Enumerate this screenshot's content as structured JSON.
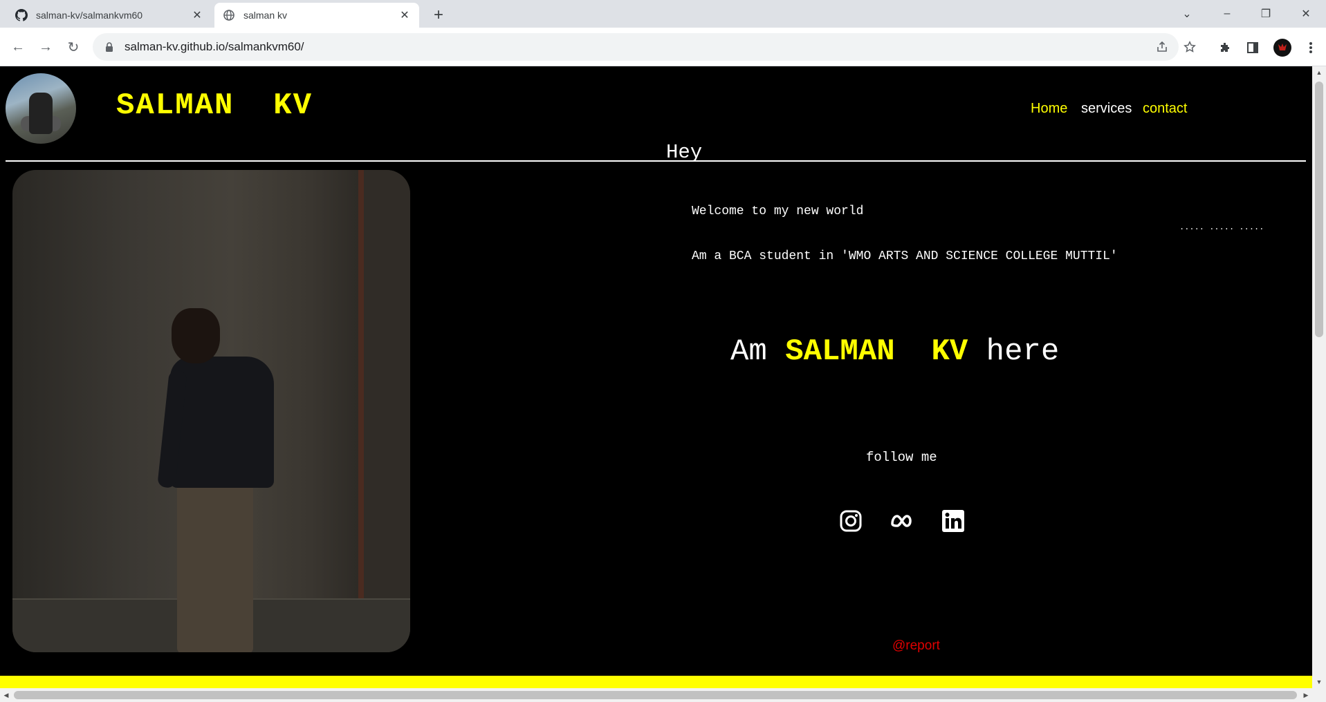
{
  "browser": {
    "tabs": [
      {
        "title": "salman-kv/salmankvm60",
        "favicon": "github-icon"
      },
      {
        "title": "salman kv",
        "favicon": "globe-icon"
      }
    ],
    "url": "salman-kv.github.io/salmankvm60/"
  },
  "header": {
    "brand": "SALMAN  KV",
    "nav": [
      {
        "label": "Home",
        "color": "#ffff00"
      },
      {
        "label": "services",
        "color": "#ffffff"
      },
      {
        "label": "contact",
        "color": "#ffff00"
      }
    ]
  },
  "intro": {
    "hey": "Hey",
    "welcome": "Welcome to my new world",
    "dots": "..... ..... .....",
    "student": "Am a BCA student in 'WMO ARTS AND SCIENCE COLLEGE MUTTIL'",
    "hero_pre": "Am ",
    "hero_name": "SALMAN  KV",
    "hero_post": " here",
    "follow": "follow me"
  },
  "social": [
    {
      "name": "instagram-icon"
    },
    {
      "name": "meta-icon"
    },
    {
      "name": "linkedin-icon"
    }
  ],
  "footer": {
    "report": "@report"
  },
  "colors": {
    "accent": "#ffff00",
    "background": "#000000",
    "report": "#e00000"
  }
}
